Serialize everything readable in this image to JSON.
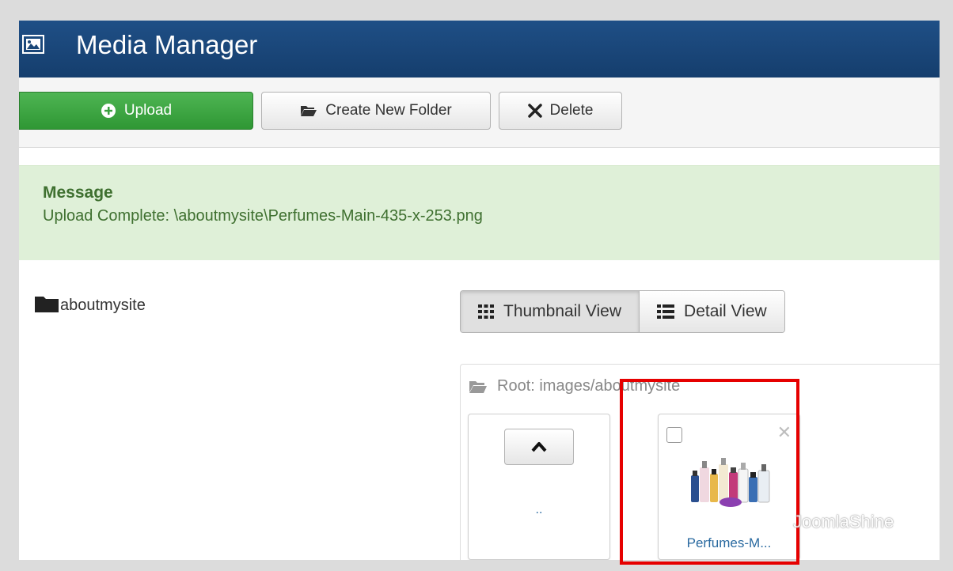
{
  "header": {
    "title": "Media Manager",
    "icon": "image-icon"
  },
  "toolbar": {
    "upload_label": "Upload",
    "create_folder_label": "Create New Folder",
    "delete_label": "Delete"
  },
  "message": {
    "heading": "Message",
    "text": "Upload Complete: \\aboutmysite\\Perfumes-Main-435-x-253.png"
  },
  "folder_tree": {
    "items": [
      {
        "label": "aboutmysite",
        "icon": "folder-icon"
      }
    ]
  },
  "view_tabs": [
    {
      "label": "Thumbnail View",
      "icon": "grid-icon",
      "active": true
    },
    {
      "label": "Detail View",
      "icon": "list-icon",
      "active": false
    }
  ],
  "browser": {
    "breadcrumb": "Root: images/aboutmysite",
    "up_item": {
      "label": ".."
    },
    "files": [
      {
        "name": "Perfumes-M...",
        "icon": "perfume-bottles-image"
      }
    ]
  },
  "watermark": {
    "text": "JoomlaShine"
  },
  "colors": {
    "header": "#1a4677",
    "upload": "#43a047",
    "alert_bg": "#dff0d8",
    "alert_text": "#3f7030",
    "highlight": "#e60000"
  }
}
